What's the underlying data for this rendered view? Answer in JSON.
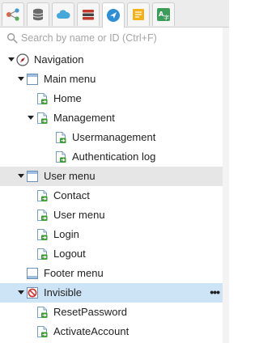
{
  "tabs": [
    {
      "name": "share-tab",
      "icon": "share-icon",
      "color": "#e8623a",
      "active": false
    },
    {
      "name": "database-tab",
      "icon": "database-icon",
      "color": "#6a6a6a",
      "active": false
    },
    {
      "name": "cloud-tab",
      "icon": "cloud-icon",
      "color": "#46a7d9",
      "active": false
    },
    {
      "name": "tools-tab",
      "icon": "tools-icon",
      "color": "#c0392b",
      "active": false
    },
    {
      "name": "navigation-tab",
      "icon": "navigation-icon",
      "color": "#2f8fd6",
      "active": true
    },
    {
      "name": "notes-tab",
      "icon": "notes-icon",
      "color": "#f2b21b",
      "active": false
    },
    {
      "name": "translate-tab",
      "icon": "translate-icon",
      "color": "#3c9d5b",
      "active": false
    }
  ],
  "search": {
    "placeholder": "Search by name or ID (Ctrl+F)",
    "value": ""
  },
  "tree": [
    {
      "label": "Navigation",
      "depth": 0,
      "icon": "compass-icon",
      "expandable": true,
      "expanded": true,
      "state": ""
    },
    {
      "label": "Main menu",
      "depth": 1,
      "icon": "menu-icon",
      "expandable": true,
      "expanded": true,
      "state": ""
    },
    {
      "label": "Home",
      "depth": 2,
      "icon": "page-icon",
      "expandable": false,
      "state": ""
    },
    {
      "label": "Management",
      "depth": 2,
      "icon": "page-icon",
      "expandable": true,
      "expanded": true,
      "state": ""
    },
    {
      "label": "Usermanagement",
      "depth": 3,
      "icon": "page-icon",
      "expandable": false,
      "state": ""
    },
    {
      "label": "Authentication log",
      "depth": 3,
      "icon": "page-icon",
      "expandable": false,
      "state": ""
    },
    {
      "label": "User menu",
      "depth": 1,
      "icon": "menu-icon",
      "expandable": true,
      "expanded": true,
      "state": "hover"
    },
    {
      "label": "Contact",
      "depth": 2,
      "icon": "page-icon",
      "expandable": false,
      "state": ""
    },
    {
      "label": "User menu",
      "depth": 2,
      "icon": "page-icon",
      "expandable": false,
      "state": ""
    },
    {
      "label": "Login",
      "depth": 2,
      "icon": "page-icon",
      "expandable": false,
      "state": ""
    },
    {
      "label": "Logout",
      "depth": 2,
      "icon": "page-icon",
      "expandable": false,
      "state": ""
    },
    {
      "label": "Footer menu",
      "depth": 1,
      "icon": "footer-menu-icon",
      "expandable": false,
      "state": ""
    },
    {
      "label": "Invisible",
      "depth": 1,
      "icon": "invisible-icon",
      "expandable": true,
      "expanded": true,
      "state": "selected",
      "more": "•••"
    },
    {
      "label": "ResetPassword",
      "depth": 2,
      "icon": "page-icon",
      "expandable": false,
      "state": ""
    },
    {
      "label": "ActivateAccount",
      "depth": 2,
      "icon": "page-icon",
      "expandable": false,
      "state": ""
    }
  ],
  "colors": {
    "selected_row": "#cde3f6",
    "hover_row": "#e6e6e6",
    "page_icon_green": "#3f9b35",
    "invisible_red": "#d0312d"
  }
}
